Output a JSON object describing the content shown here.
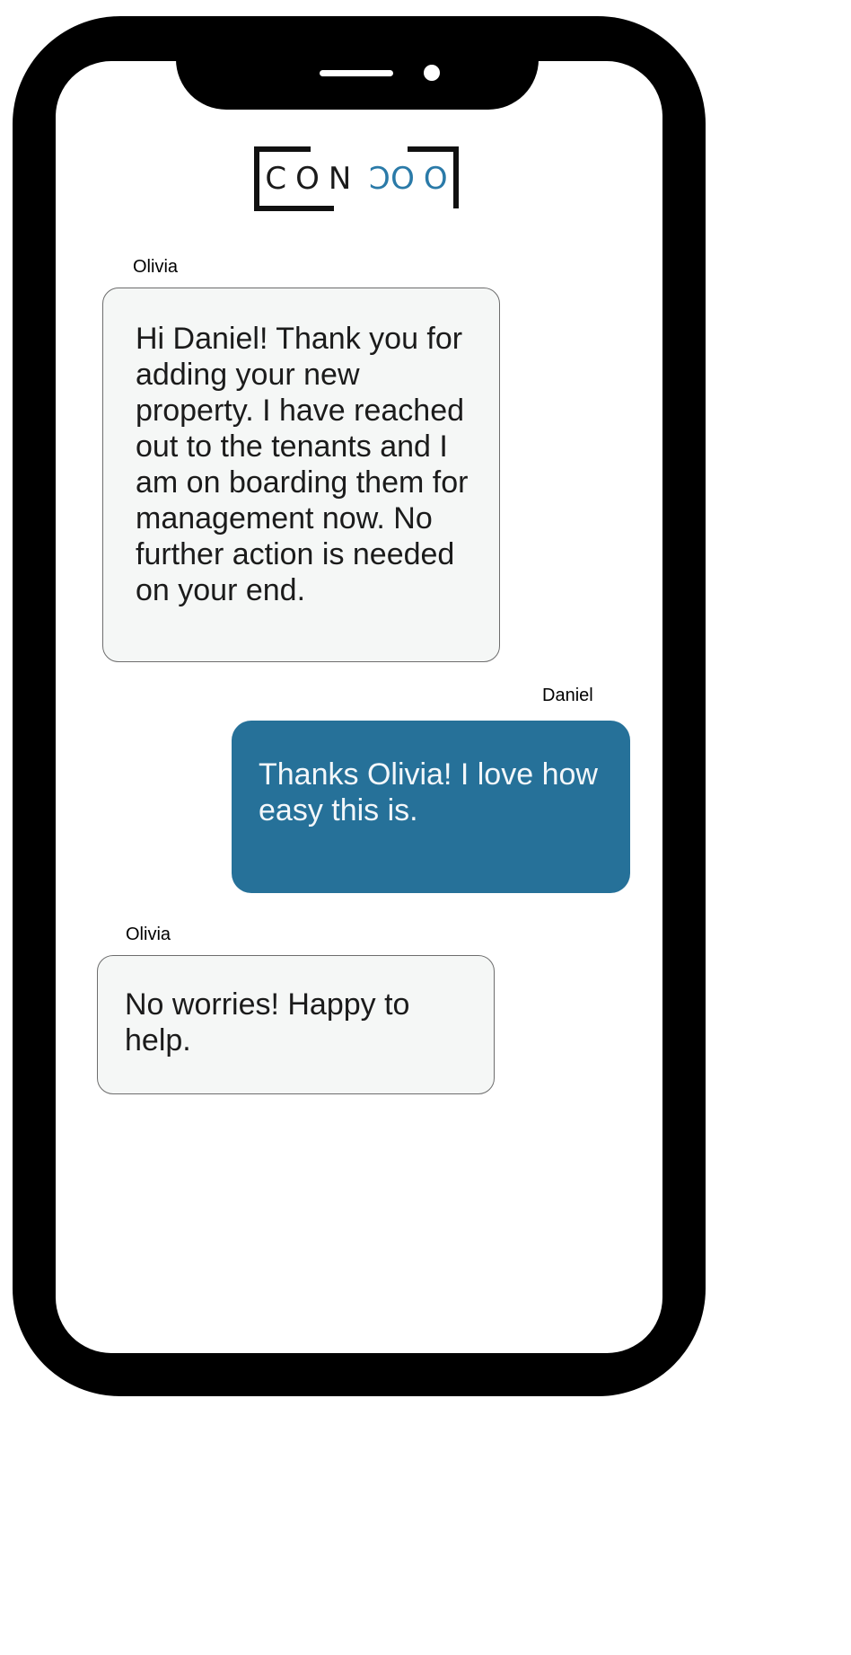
{
  "app": {
    "logo": {
      "text_start": "CON",
      "text_end": "OO",
      "mirrored_glyph": "C",
      "accent_color": "#2a7aa8"
    }
  },
  "colors": {
    "frame": "#000000",
    "incoming_bubble": "#f5f7f6",
    "outgoing_bubble": "#267199"
  },
  "messages": [
    {
      "sender": "Olivia",
      "direction": "incoming",
      "text": "Hi Daniel! Thank you for adding your new property. I have reached out to the tenants and I am on boarding them for management now. No further action is needed on your end."
    },
    {
      "sender": "Daniel",
      "direction": "outgoing",
      "text": "Thanks Olivia! I love how easy this is."
    },
    {
      "sender": "Olivia",
      "direction": "incoming",
      "text": "No worries! Happy to help."
    }
  ]
}
